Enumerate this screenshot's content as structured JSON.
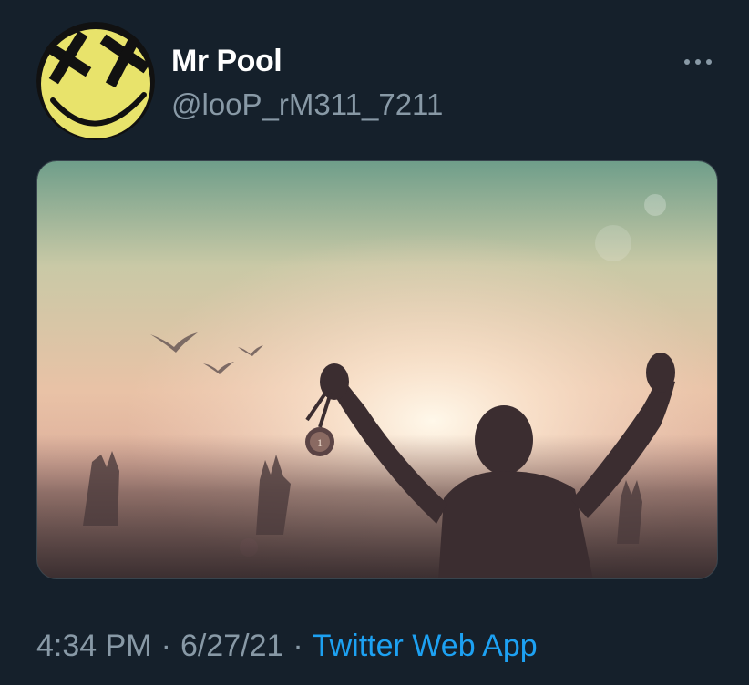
{
  "author": {
    "display_name": "Mr Pool",
    "handle": "@looP_rM311_7211",
    "avatar_icon": "smiley-face-avatar"
  },
  "menu": {
    "icon": "more-dots-icon"
  },
  "media": {
    "description_icon": "silhouette-medal-sunset-photo",
    "medal_text": "1"
  },
  "meta": {
    "time": "4:34 PM",
    "separator": "·",
    "date": "6/27/21",
    "source": "Twitter Web App"
  },
  "colors": {
    "background": "#15202b",
    "secondary_text": "#8899a6",
    "link": "#1da1f2"
  }
}
